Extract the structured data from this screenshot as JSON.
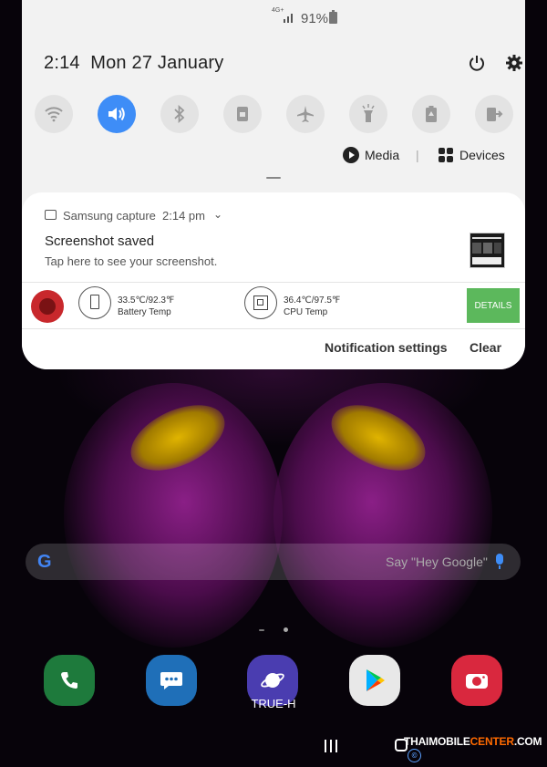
{
  "status_bar": {
    "network": "4G+",
    "battery_percent": "91%"
  },
  "header": {
    "time": "2:14",
    "date": "Mon 27 January"
  },
  "quick_settings": [
    {
      "name": "wifi",
      "active": false
    },
    {
      "name": "sound",
      "active": true
    },
    {
      "name": "bluetooth",
      "active": false
    },
    {
      "name": "lock-rotation",
      "active": false
    },
    {
      "name": "airplane-mode",
      "active": false
    },
    {
      "name": "flashlight",
      "active": false
    },
    {
      "name": "power-saving",
      "active": false
    },
    {
      "name": "secure-folder",
      "active": false
    }
  ],
  "media_row": {
    "media_label": "Media",
    "devices_label": "Devices"
  },
  "notification": {
    "app": "Samsung capture",
    "time": "2:14 pm",
    "title": "Screenshot saved",
    "text": "Tap here to see your screenshot."
  },
  "antutu": {
    "battery": {
      "value": "33.5℃/92.3℉",
      "label": "Battery Temp"
    },
    "cpu": {
      "value": "36.4℃/97.5℉",
      "label": "CPU Temp"
    },
    "details_label": "DETAILS"
  },
  "actions": {
    "notification_settings": "Notification settings",
    "clear": "Clear"
  },
  "search": {
    "logo": "G",
    "hint": "Say \"Hey Google\""
  },
  "dock": {
    "apps": [
      {
        "name": "phone",
        "color": "#1e7a3c"
      },
      {
        "name": "messages",
        "color": "#1f6fb8"
      },
      {
        "name": "internet",
        "color": "#4a3db0"
      },
      {
        "name": "play-store",
        "color": "#e8e8e8"
      },
      {
        "name": "camera",
        "color": "#d9283e"
      }
    ],
    "carrier": "TRUE-H"
  },
  "watermark": {
    "prefix": "THAIMOBILE",
    "highlight": "CENTER",
    "suffix": ".COM",
    "symbol": "©"
  },
  "colors": {
    "accent": "#3e8df7",
    "details_green": "#5cb85c"
  }
}
